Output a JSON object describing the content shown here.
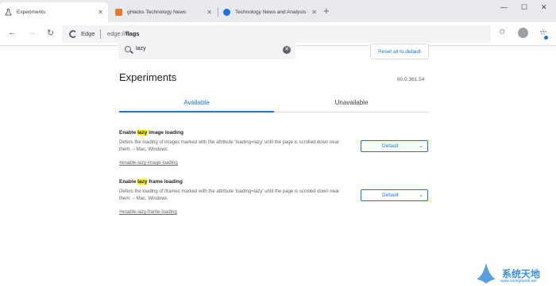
{
  "browser": {
    "tabs": [
      {
        "title": "Experiments",
        "active": true
      },
      {
        "title": "gHacks Technology News",
        "active": false
      },
      {
        "title": "Technology News and Analysis -",
        "active": false
      }
    ],
    "new_tab": "+",
    "window_controls": {
      "minimize": "—",
      "maximize": "☐",
      "close": "✕"
    },
    "omnibox": {
      "brand": "Edge",
      "url_prefix": "edge://",
      "url_path": "flags"
    },
    "icons": [
      "back-arrow-icon",
      "forward-arrow-icon",
      "refresh-icon",
      "star-icon",
      "favorites-icon",
      "profile-icon",
      "more-icon"
    ]
  },
  "flags_page": {
    "search": {
      "value": "lazy"
    },
    "reset_label": "Reset all to default",
    "title": "Experiments",
    "version": "80.0.361.54",
    "tabs": {
      "available": "Available",
      "unavailable": "Unavailable"
    },
    "flags": [
      {
        "title_pre": "Enable ",
        "title_hl": "lazy",
        "title_post": " image loading",
        "desc": "Defers the loading of images marked with the attribute 'loading=lazy' until the page is scrolled down near them. – Mac, Windows",
        "link": "#enable-lazy-image-loading",
        "value": "Default"
      },
      {
        "title_pre": "Enable ",
        "title_hl": "lazy",
        "title_post": " frame loading",
        "desc": "Defers the loading of iframes marked with the attribute 'loading=lazy' until the page is scrolled down near them. – Mac, Windows",
        "link": "#enable-lazy-frame-loading",
        "value": "Default"
      }
    ]
  },
  "watermark": {
    "text": "系统天地",
    "url": "www.xitongtiandi.net"
  },
  "colors": {
    "accent": "#1a73e8",
    "highlight": "#fff200",
    "tabstrip": "#e8eaed"
  }
}
